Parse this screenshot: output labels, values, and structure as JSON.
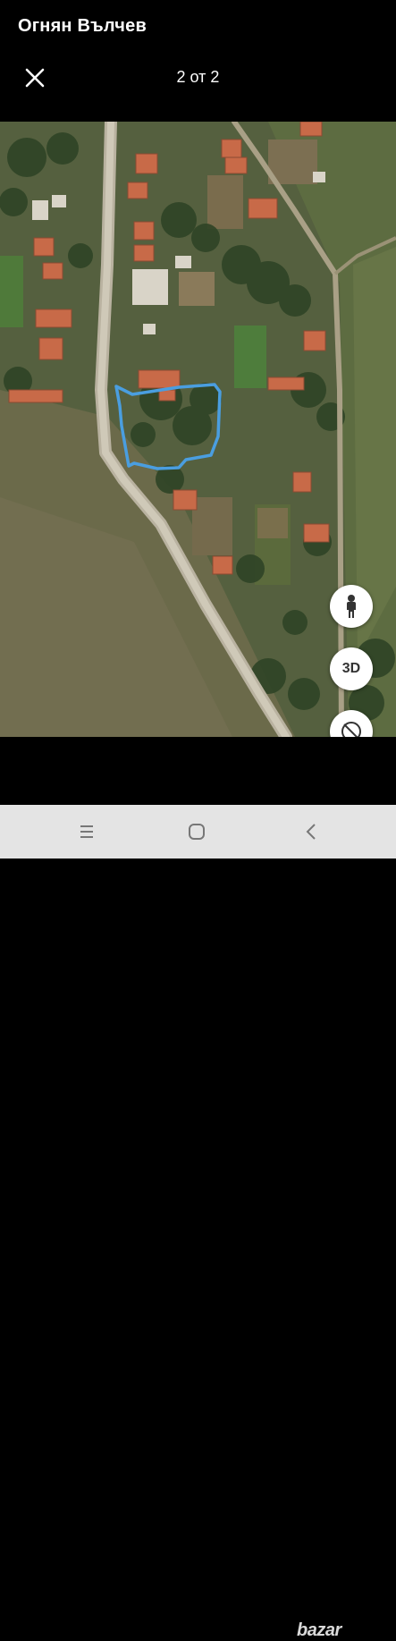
{
  "header": {
    "owner_name": "Огнян Вълчев",
    "photo_counter": "2 от 2",
    "close_icon": "close-icon"
  },
  "map_controls": {
    "street_view_icon": "pegman-icon",
    "view_3d_label": "3D",
    "compass_icon": "compass-icon"
  },
  "navigation_bar": {
    "recents_icon": "recents-icon",
    "home_icon": "home-icon",
    "back_icon": "back-icon"
  },
  "watermark": {
    "text": "bazar"
  },
  "colors": {
    "boundary_outline": "#4a9ee0",
    "navbar_background": "#e4e4e4"
  }
}
